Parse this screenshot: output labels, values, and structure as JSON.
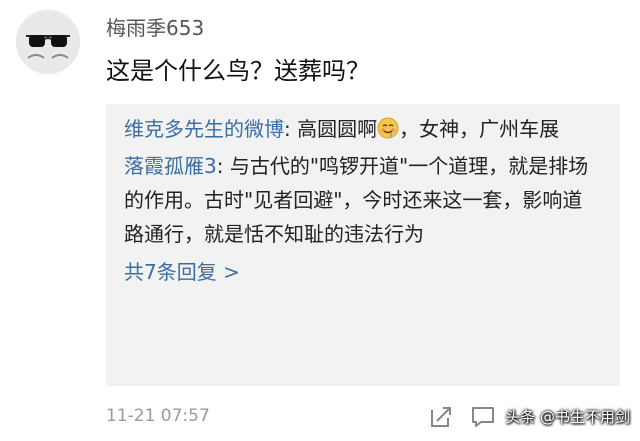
{
  "comment": {
    "username": "梅雨季653",
    "text": "这是个什么鸟？送葬吗？",
    "timestamp": "11-21 07:57"
  },
  "replies": [
    {
      "name": "维克多先生的微博",
      "text_before": ": 高圆圆啊",
      "emoji": "drooling-face-emoji",
      "text_after": "，女神，广州车展"
    },
    {
      "name": "落霞孤雁3",
      "text": ": 与古代的\"鸣锣开道\"一个道理，就是排场的作用。古时\"见者回避\"，今时还来这一套，影响道路通行，就是恬不知耻的违法行为"
    }
  ],
  "more_replies_label": "共7条回复 >",
  "actions": {
    "share_icon": "share-edit-icon",
    "comment_icon": "comment-icon"
  },
  "watermark": "头条 @书生不用剑",
  "colors": {
    "link_blue": "#3a6ea5",
    "reply_bg": "#f2f2f2",
    "muted_gray": "#9a9a9a"
  }
}
